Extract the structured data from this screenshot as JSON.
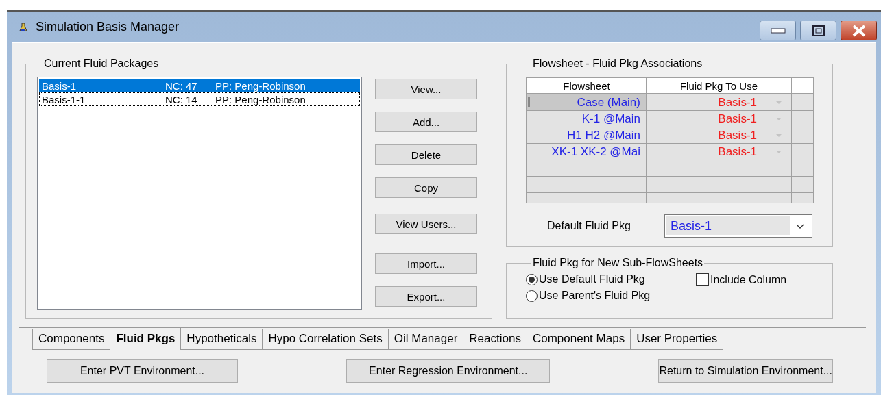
{
  "window": {
    "title": "Simulation Basis Manager"
  },
  "fluid_packages": {
    "title": "Current Fluid Packages",
    "items": [
      {
        "name": "Basis-1",
        "nc": "NC: 47",
        "pp": "PP: Peng-Robinson",
        "selected": true,
        "focused": false
      },
      {
        "name": "Basis-1-1",
        "nc": "NC: 14",
        "pp": "PP: Peng-Robinson",
        "selected": false,
        "focused": true
      }
    ],
    "buttons": [
      "View...",
      "Add...",
      "Delete",
      "Copy",
      "View Users...",
      "Import...",
      "Export..."
    ]
  },
  "associations": {
    "title": "Flowsheet - Fluid Pkg Associations",
    "columns": [
      "Flowsheet",
      "Fluid Pkg To Use"
    ],
    "rows": [
      {
        "flowsheet": "Case (Main)",
        "fluid_pkg": "Basis-1",
        "selected": true
      },
      {
        "flowsheet": "K-1 @Main",
        "fluid_pkg": "Basis-1",
        "selected": false
      },
      {
        "flowsheet": "H1 H2 @Main",
        "fluid_pkg": "Basis-1",
        "selected": false
      },
      {
        "flowsheet": "XK-1 XK-2 @Mai",
        "fluid_pkg": "Basis-1",
        "selected": false
      }
    ],
    "default_label": "Default Fluid Pkg",
    "default_value": "Basis-1"
  },
  "sub_flowsheets": {
    "title": "Fluid Pkg for New Sub-FlowSheets",
    "options": [
      {
        "label": "Use Default Fluid Pkg",
        "selected": true
      },
      {
        "label": "Use Parent's Fluid Pkg",
        "selected": false
      }
    ],
    "include_column": {
      "label": "Include Column",
      "checked": false
    }
  },
  "tabs": [
    {
      "label": "Components",
      "selected": false
    },
    {
      "label": "Fluid Pkgs",
      "selected": true
    },
    {
      "label": "Hypotheticals",
      "selected": false
    },
    {
      "label": "Hypo Correlation Sets",
      "selected": false
    },
    {
      "label": "Oil Manager",
      "selected": false
    },
    {
      "label": "Reactions",
      "selected": false
    },
    {
      "label": "Component Maps",
      "selected": false
    },
    {
      "label": "User Properties",
      "selected": false
    }
  ],
  "actions": [
    "Enter PVT Environment...",
    "Enter Regression Environment...",
    "Return to Simulation Environment..."
  ]
}
